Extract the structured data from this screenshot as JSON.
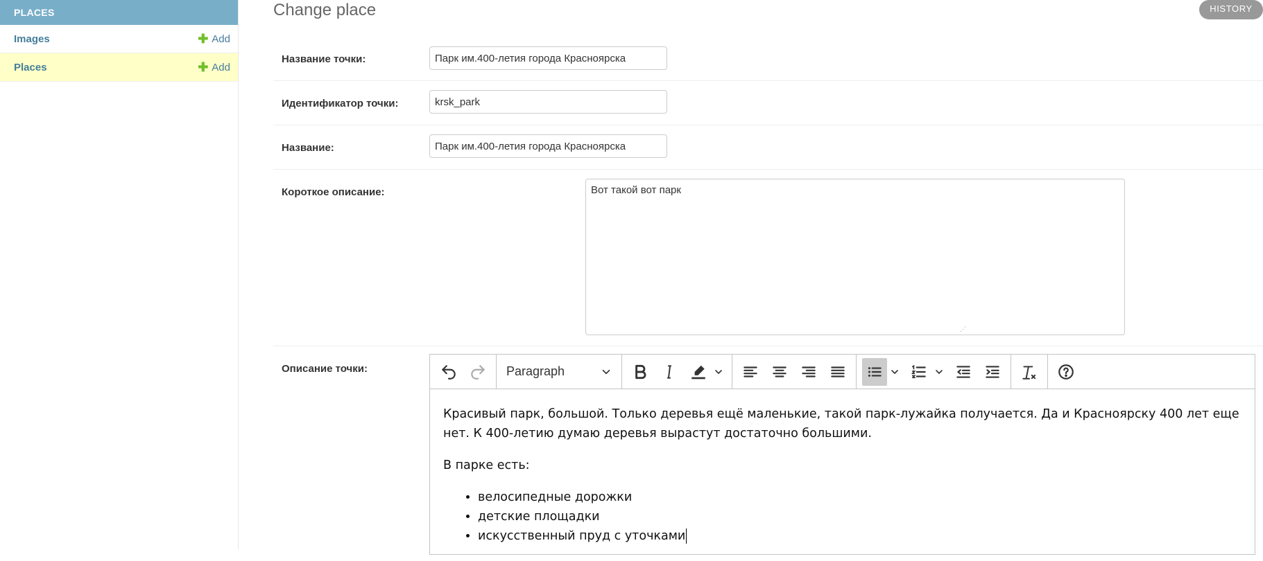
{
  "sidebar": {
    "caption": "PLACES",
    "models": [
      {
        "label": "Images",
        "add_label": "Add"
      },
      {
        "label": "Places",
        "add_label": "Add"
      }
    ]
  },
  "page": {
    "title": "Change place",
    "history_label": "HISTORY"
  },
  "form": {
    "point_name": {
      "label": "Название точки:",
      "value": "Парк им.400-летия города Красноярска"
    },
    "point_id": {
      "label": "Идентификатор точки:",
      "value": "krsk_park"
    },
    "name": {
      "label": "Название:",
      "value": "Парк им.400-летия города Красноярска"
    },
    "short_description": {
      "label": "Короткое описание:",
      "value": "Вот такой вот парк"
    },
    "long_description": {
      "label": "Описание точки:"
    }
  },
  "editor": {
    "paragraph_label": "Paragraph",
    "toolbar_icons": [
      "undo-icon",
      "redo-icon",
      "bold-icon",
      "italic-icon",
      "highlight-icon",
      "align-left-icon",
      "align-center-icon",
      "align-right-icon",
      "align-justify-icon",
      "bulleted-list-icon",
      "numbered-list-icon",
      "outdent-icon",
      "indent-icon",
      "remove-format-icon",
      "help-icon"
    ],
    "content": {
      "paragraphs": [
        "Красивый парк, большой. Только деревья ещё маленькие, такой парк-лужайка получается. Да и Красноярску 400 лет еще нет. К 400-летию думаю деревья вырастут достаточно большими.",
        "В парке есть:"
      ],
      "list_items": [
        "велосипедные дорожки",
        "детские площадки",
        "искусственный пруд с уточками"
      ]
    }
  },
  "colors": {
    "sidebar_caption_bg": "#79aec8",
    "current_row_bg": "#ffffc8",
    "link": "#447e9b",
    "add_icon": "#70bf2b",
    "history_bg": "#999999"
  }
}
